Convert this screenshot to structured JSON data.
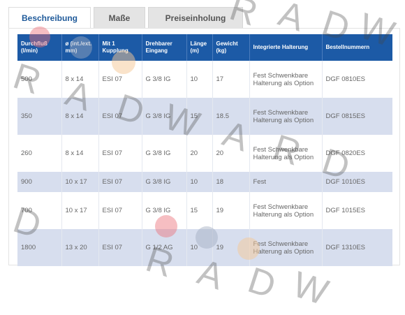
{
  "tabs": [
    {
      "label": "Beschreibung",
      "active": true
    },
    {
      "label": "Maße",
      "active": false
    },
    {
      "label": "Preiseinholung",
      "active": false
    }
  ],
  "table": {
    "headers": [
      "Durchfluß (l/min)",
      "ø (int./ext. mm)",
      "Mit 1 Kupplung",
      "Drehbarer Eingang",
      "Länge (m)",
      "Gewicht (kg)",
      "Integrierte Halterung",
      "Bestellnummern"
    ],
    "rows": [
      [
        "500",
        "8 x 14",
        "ESI 07",
        "G 3/8 IG",
        "10",
        "17",
        "Fest Schwenkbare Halterung als Option",
        "DGF 0810ES"
      ],
      [
        "350",
        "8 x 14",
        "ESI 07",
        "G 3/8 IG",
        "15",
        "18.5",
        "Fest Schwenkbare Halterung als Option",
        "DGF 0815ES"
      ],
      [
        "260",
        "8 x 14",
        "ESI 07",
        "G 3/8 IG",
        "20",
        "20",
        "Fest Schwenkbare Halterung als Option",
        "DGF 0820ES"
      ],
      [
        "900",
        "10 x 17",
        "ESI 07",
        "G 3/8 IG",
        "10",
        "18",
        "Fest",
        "DGF 1010ES"
      ],
      [
        "700",
        "10 x 17",
        "ESI 07",
        "G 3/8 IG",
        "15",
        "19",
        "Fest Schwenkbare Halterung als Option",
        "DGF 1015ES"
      ],
      [
        "1800",
        "13 x 20",
        "ESI 07",
        "G 1/2 AG",
        "10",
        "19",
        "Fest Schwenkbare Halterung als Option",
        "DGF 1310ES"
      ]
    ]
  },
  "watermark": "RADWARD",
  "colors": {
    "header_bg": "#1c5aa6",
    "stripe": "#d7deee",
    "active_tab_text": "#1f5a9a"
  }
}
